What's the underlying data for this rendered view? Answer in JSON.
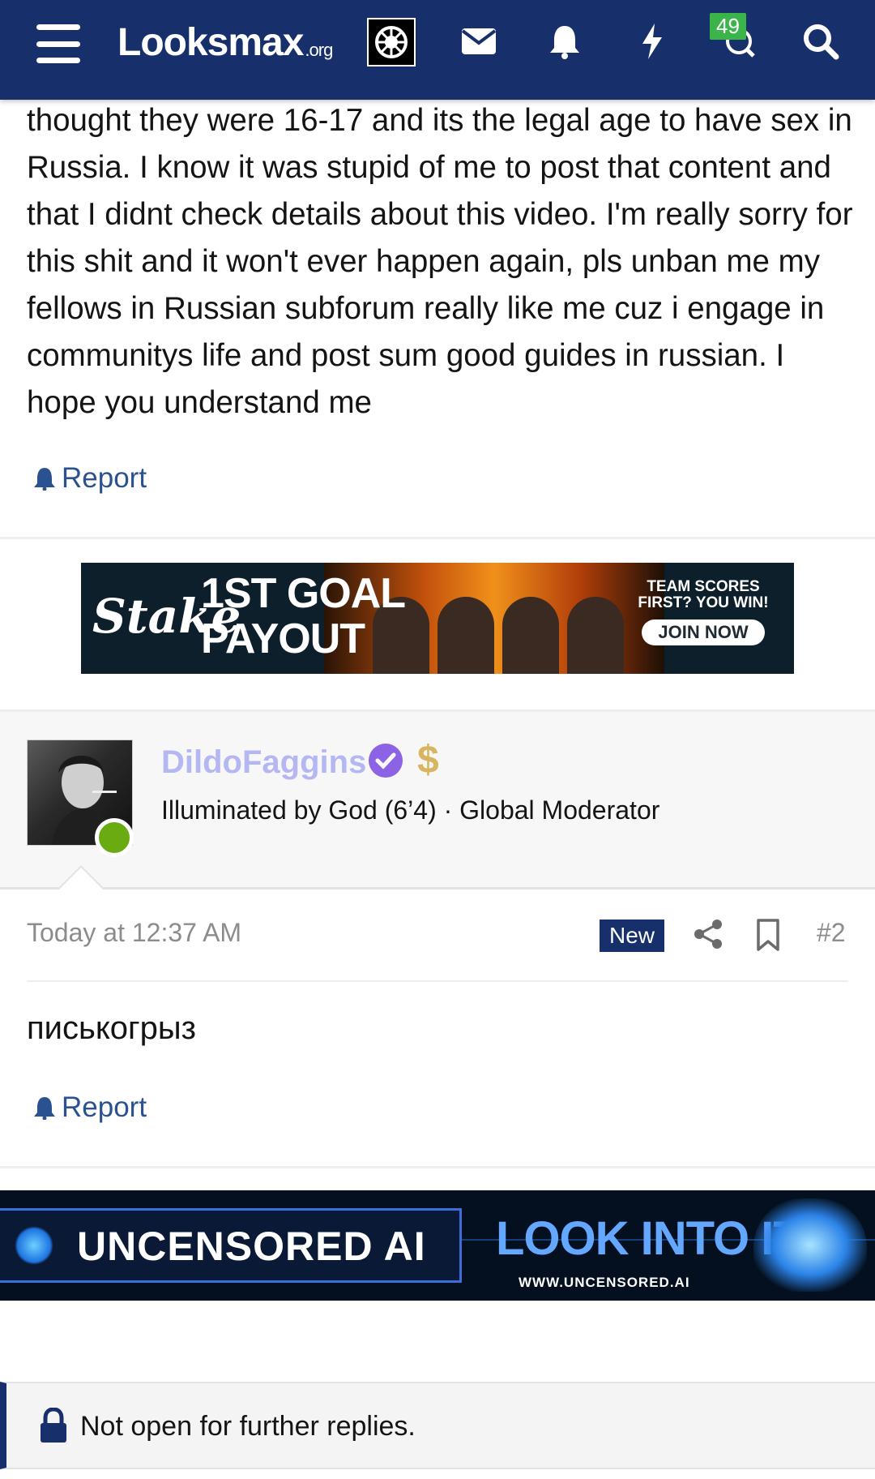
{
  "header": {
    "logo_main": "Looksmax",
    "logo_suffix": ".org",
    "badge_count": "49"
  },
  "post1": {
    "text": "thought they were 16-17 and its the legal age to have sex in Russia. I know it was stupid of me to post that content and that I didnt check details about this video. I'm really sorry for this shit and it won't ever happen again, pls unban me my fellows in Russian subforum really like me cuz i engage in communitys life and post sum good guides in russian. I hope you understand me",
    "report_label": "Report"
  },
  "ad1": {
    "brand": "Stake",
    "headline_line1": "1ST GOAL",
    "headline_line2": "PAYOUT",
    "tagline": "TEAM SCORES FIRST? YOU WIN!",
    "cta": "JOIN NOW"
  },
  "post2": {
    "username": "DildoFaggins",
    "user_title": "Illuminated by God (6’4) · Global Moderator",
    "date": "Today at 12:37 AM",
    "new_badge": "New",
    "post_number": "#2",
    "body": "писькогрыз",
    "report_label": "Report"
  },
  "ad2": {
    "headline": "UNCENSORED AI",
    "cta": "LOOK INTO IT",
    "url": "WWW.UNCENSORED.AI"
  },
  "notice": {
    "text": "Not open for further replies."
  },
  "colors": {
    "header_bg": "#17306b",
    "link": "#2a5291",
    "username": "#b4b7f2",
    "online": "#6aab11",
    "badge": "#3bb54a"
  }
}
